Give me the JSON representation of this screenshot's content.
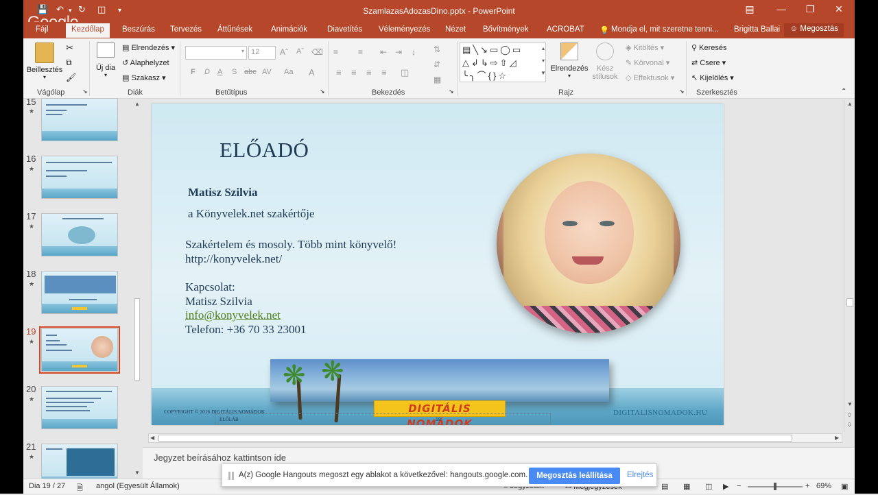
{
  "titlebar": {
    "title": "SzamlazasAdozasDino.pptx - PowerPoint",
    "overlay_logo": "Google"
  },
  "tabs": {
    "items": [
      "Fájl",
      "Kezdőlap",
      "Beszúrás",
      "Tervezés",
      "Áttűnések",
      "Animációk",
      "Diavetítés",
      "Véleményezés",
      "Nézet",
      "Bővítmények",
      "ACROBAT"
    ],
    "active": "Kezdőlap",
    "tell_me": "Mondja el, mit szeretne tenni...",
    "user": "Brigitta Ballai",
    "share": "Megosztás"
  },
  "ribbon": {
    "clipboard": {
      "paste": "Beillesztés",
      "label": "Vágólap"
    },
    "slides": {
      "new_slide": "Új dia",
      "layout": "Elrendezés",
      "reset": "Alaphelyzet",
      "section": "Szakasz",
      "label": "Diák"
    },
    "font": {
      "name_value": "",
      "size_value": "12",
      "bold": "F",
      "italic": "D",
      "underline": "A",
      "shadow": "S",
      "strike": "abc",
      "spacing": "AV",
      "case": "Aa",
      "label": "Betűtípus"
    },
    "paragraph": {
      "label": "Bekezdés"
    },
    "drawing": {
      "arrange": "Elrendezés",
      "quick_styles_1": "Kész",
      "quick_styles_2": "stílusok",
      "fill": "Kitöltés",
      "outline": "Körvonal",
      "effects": "Effektusok",
      "label": "Rajz"
    },
    "editing": {
      "find": "Keresés",
      "replace": "Csere",
      "select": "Kijelölés",
      "label": "Szerkesztés"
    }
  },
  "slide_panel": {
    "slides": [
      {
        "num": "15"
      },
      {
        "num": "16"
      },
      {
        "num": "17"
      },
      {
        "num": "18"
      },
      {
        "num": "19",
        "active": true
      },
      {
        "num": "20"
      },
      {
        "num": "21"
      }
    ]
  },
  "slide": {
    "title": "ELŐADÓ",
    "name": "Matisz Szilvia",
    "role": "a Könyvelek.net szakértője",
    "tagline": "Szakértelem és mosoly. Több mint könyvelő!",
    "url": "http://konyvelek.net/",
    "contact_label": "Kapcsolat:",
    "contact_name": "Matisz Szilvia",
    "email": "info@konyvelek.net",
    "phone": "Telefon: +36 70 33 23001",
    "badge": "DIGITÁLIS NOMÁDOK",
    "copyright": "COPYRIGHT © 2016 DIGITÁLIS NOMÁDOK",
    "footer_label": "ELŐLÁB",
    "footer_number": "19",
    "site": "DIGITALISNOMADOK.HU"
  },
  "notes": {
    "placeholder": "Jegyzet beírásához kattintson ide"
  },
  "statusbar": {
    "slide_info": "Dia 19 / 27",
    "language": "angol (Egyesült Államok)",
    "notes_btn": "Jegyzetek",
    "comments_btn": "Megjegyzések",
    "zoom": "69%"
  },
  "hangouts": {
    "message": "A(z) Google Hangouts megoszt egy ablakot a következővel: hangouts.google.com.",
    "stop": "Megosztás leállítása",
    "hide": "Elrejtés"
  },
  "colors": {
    "accent": "#b7472a",
    "ribbon_bg": "#f3f3f3",
    "link_green": "#4f7d1c",
    "hangouts_blue": "#4a8af4"
  }
}
